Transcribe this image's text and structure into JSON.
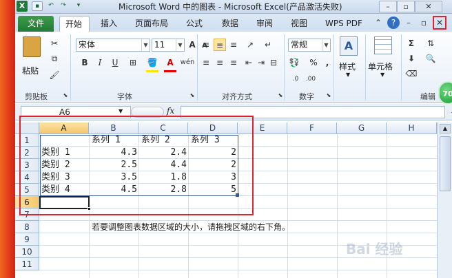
{
  "window": {
    "title": "Microsoft Word 中的图表 - Microsoft Excel(产品激活失败)",
    "app_icon": "X"
  },
  "tabs": [
    "文件",
    "开始",
    "插入",
    "页面布局",
    "公式",
    "数据",
    "审阅",
    "视图",
    "WPS PDF"
  ],
  "ribbon": {
    "clipboard": {
      "paste_label": "粘贴",
      "group_label": "剪贴板"
    },
    "font": {
      "font_name": "宋体",
      "font_size": "11",
      "group_label": "字体",
      "bold": "B",
      "italic": "I",
      "underline": "U",
      "grow": "A",
      "shrink": "A",
      "wen": "wén"
    },
    "alignment": {
      "group_label": "对齐方式"
    },
    "number": {
      "format": "常规",
      "group_label": "数字",
      "percent": "%",
      "comma": ","
    },
    "styles": {
      "label": "样式"
    },
    "cells": {
      "label": "单元格"
    },
    "editing": {
      "group_label": "编辑",
      "sigma": "Σ"
    }
  },
  "badge": {
    "text": "70"
  },
  "formula": {
    "namebox": "A6",
    "fx": "fx"
  },
  "sheet": {
    "columns": [
      "A",
      "B",
      "C",
      "D",
      "E",
      "F",
      "G",
      "H"
    ],
    "rows": [
      "1",
      "2",
      "3",
      "4",
      "5",
      "6",
      "7",
      "8",
      "9",
      "10",
      "11"
    ],
    "headers": [
      "系列 1",
      "系列 2",
      "系列 3"
    ],
    "data": [
      {
        "category": "类别 1",
        "s1": "4.3",
        "s2": "2.4",
        "s3": "2"
      },
      {
        "category": "类别 2",
        "s1": "2.5",
        "s2": "4.4",
        "s3": "2"
      },
      {
        "category": "类别 3",
        "s1": "3.5",
        "s2": "1.8",
        "s3": "3"
      },
      {
        "category": "类别 4",
        "s1": "4.5",
        "s2": "2.8",
        "s3": "5"
      }
    ],
    "note": "若要调整图表数据区域的大小，请拖拽区域的右下角。"
  },
  "watermark": {
    "text": "Bai 经验"
  },
  "colors": {
    "accent_red": "#e0232e",
    "file_tab": "#2a8a3c",
    "selection": "#f6c76a"
  }
}
